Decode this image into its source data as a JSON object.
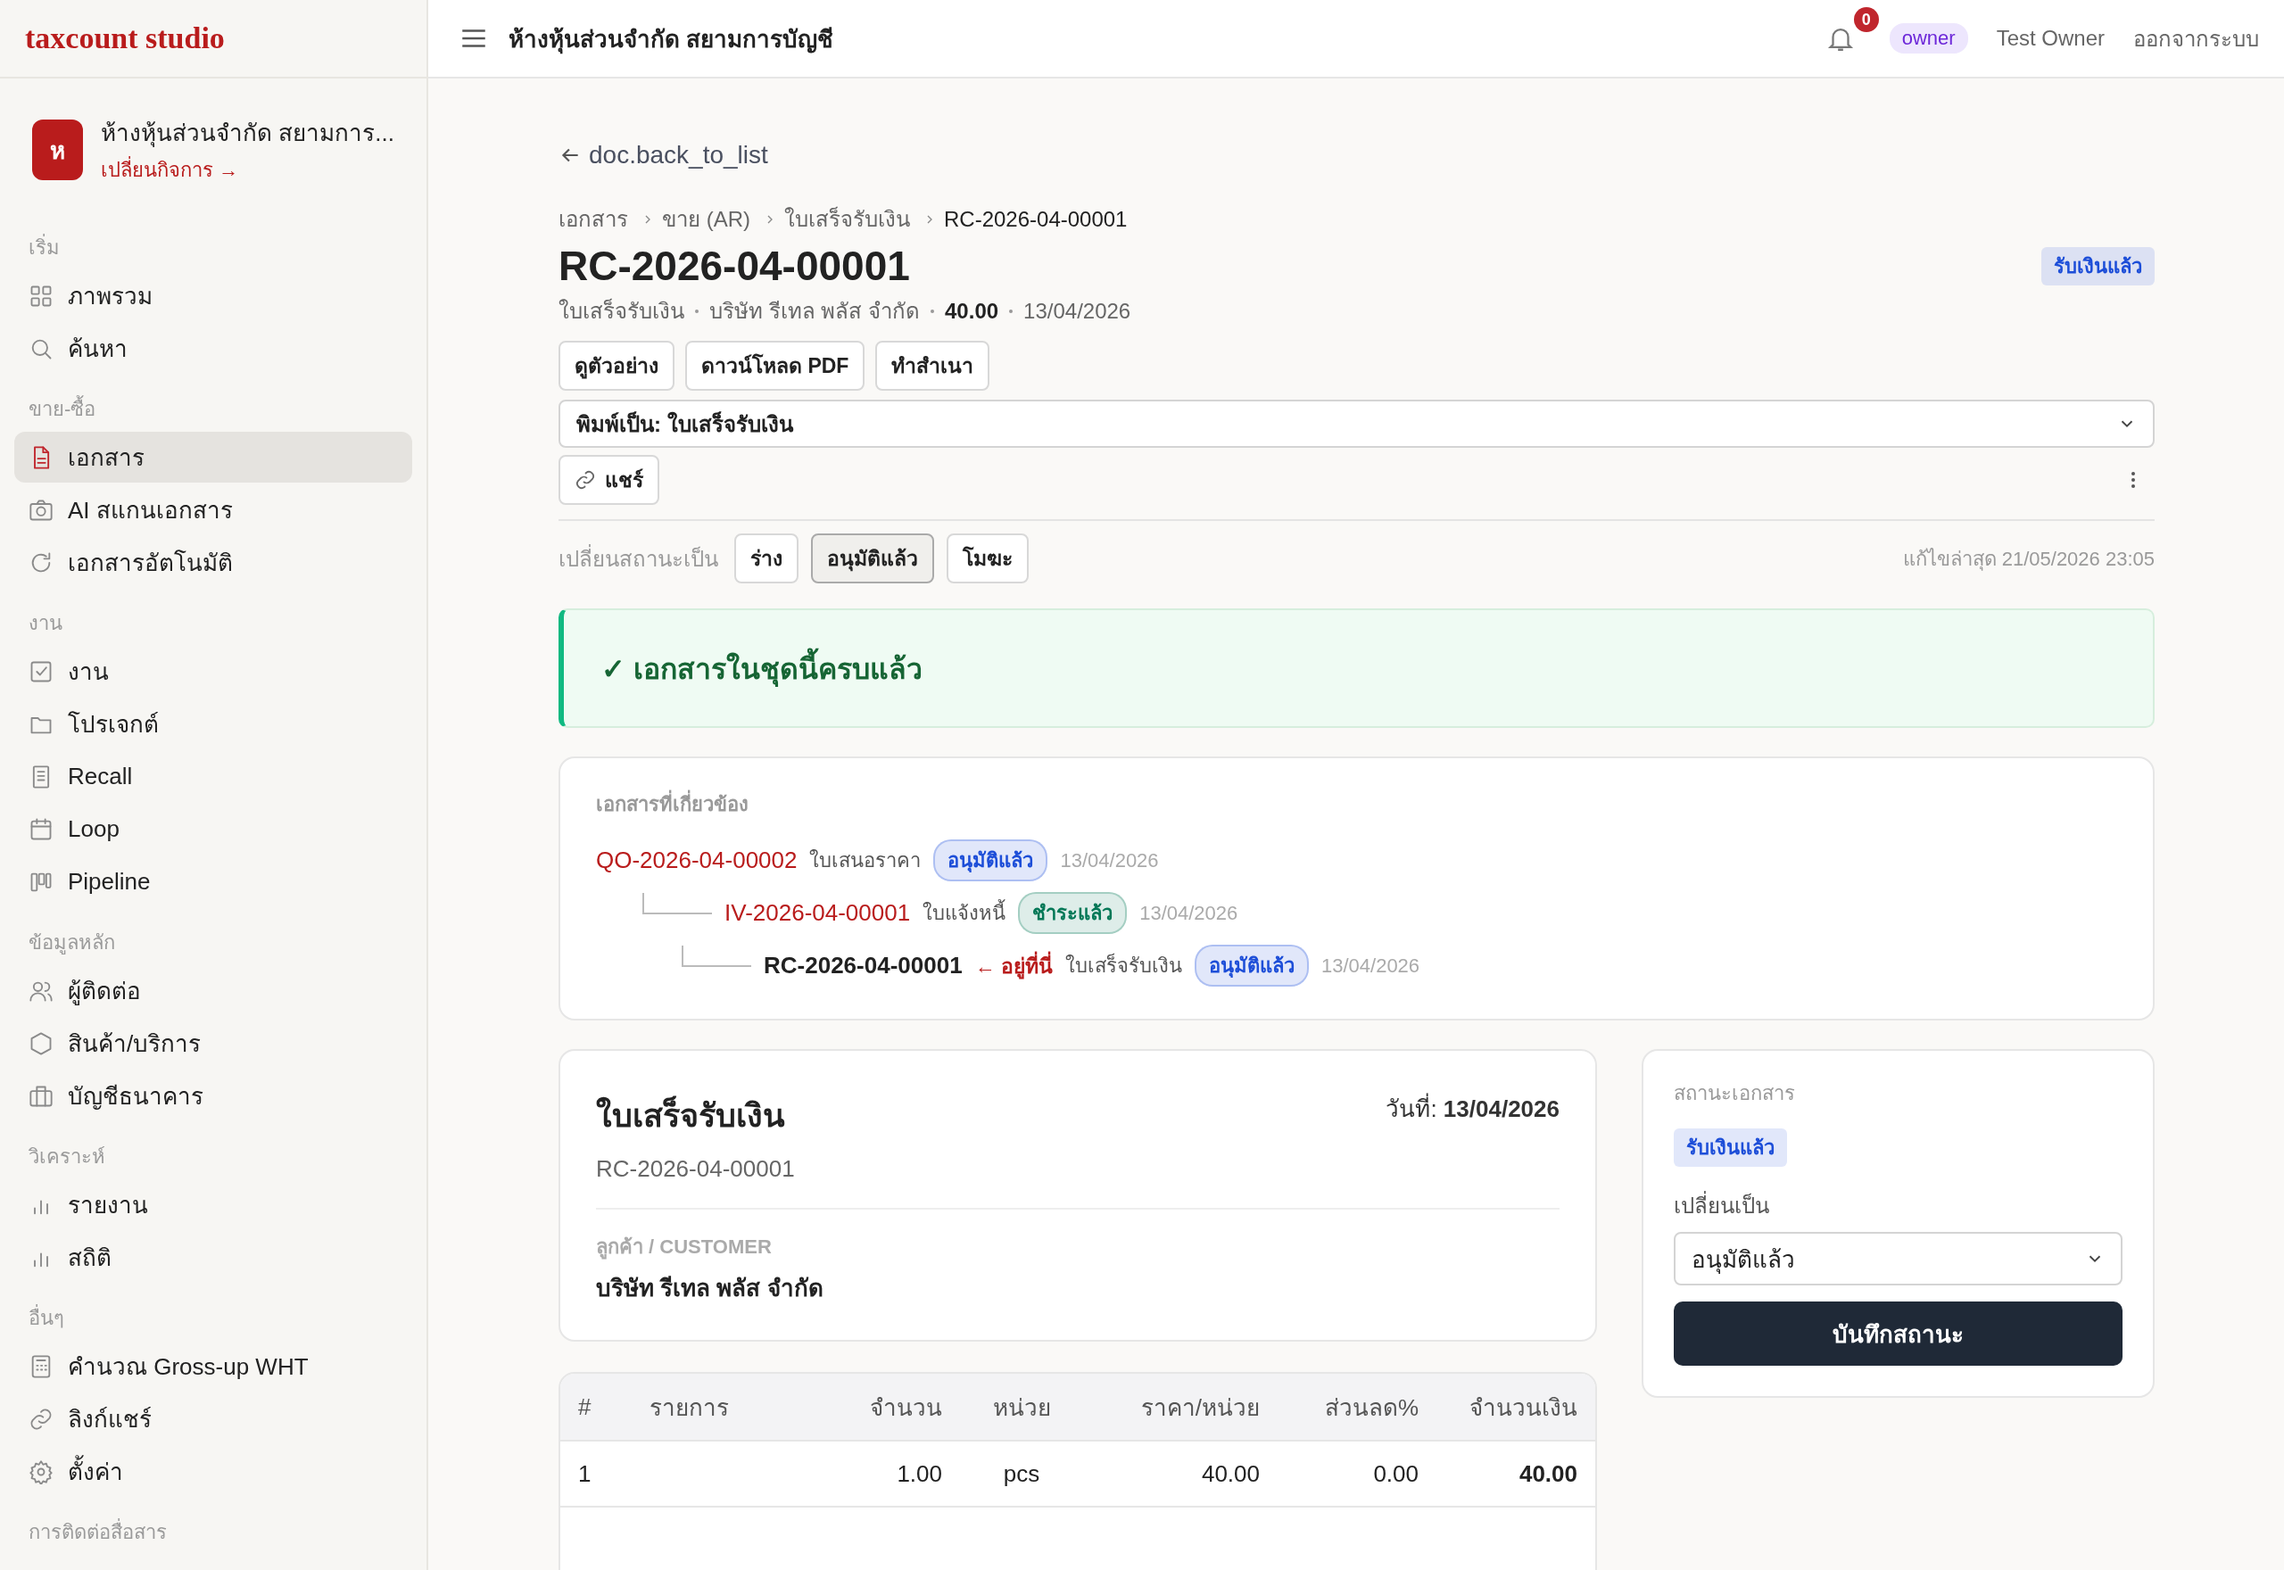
{
  "brand": "taxcount studio",
  "company": {
    "initial": "ห",
    "name": "ห้างหุ้นส่วนจำกัด สยามการ...",
    "switch_label": "เปลี่ยนกิจการ →"
  },
  "sidebar": {
    "sections": [
      {
        "title": "เริ่ม",
        "items": [
          {
            "label": "ภาพรวม",
            "selected": false
          },
          {
            "label": "ค้นหา",
            "selected": false
          }
        ]
      },
      {
        "title": "ขาย-ซื้อ",
        "items": [
          {
            "label": "เอกสาร",
            "selected": true
          },
          {
            "label": "AI สแกนเอกสาร",
            "selected": false
          },
          {
            "label": "เอกสารอัตโนมัติ",
            "selected": false
          }
        ]
      },
      {
        "title": "งาน",
        "items": [
          {
            "label": "งาน",
            "selected": false
          },
          {
            "label": "โปรเจกต์",
            "selected": false
          },
          {
            "label": "Recall",
            "selected": false
          },
          {
            "label": "Loop",
            "selected": false
          },
          {
            "label": "Pipeline",
            "selected": false
          }
        ]
      },
      {
        "title": "ข้อมูลหลัก",
        "items": [
          {
            "label": "ผู้ติดต่อ",
            "selected": false
          },
          {
            "label": "สินค้า/บริการ",
            "selected": false
          },
          {
            "label": "บัญชีธนาคาร",
            "selected": false
          }
        ]
      },
      {
        "title": "วิเคราะห์",
        "items": [
          {
            "label": "รายงาน",
            "selected": false
          },
          {
            "label": "สถิติ",
            "selected": false
          }
        ]
      },
      {
        "title": "อื่นๆ",
        "items": [
          {
            "label": "คำนวณ Gross-up WHT",
            "selected": false
          },
          {
            "label": "ลิงก์แชร์",
            "selected": false
          },
          {
            "label": "ตั้งค่า",
            "selected": false
          }
        ]
      },
      {
        "title": "การติดต่อสื่อสาร"
      }
    ]
  },
  "header": {
    "title": "ห้างหุ้นส่วนจำกัด สยามการบัญชี",
    "notifications": "0",
    "role": "owner",
    "user": "Test Owner",
    "logout": "ออกจากระบบ"
  },
  "document": {
    "back_link": "doc.back_to_list",
    "breadcrumb": [
      "เอกสาร",
      "ขาย (AR)",
      "ใบเสร็จรับเงิน",
      "RC-2026-04-00001"
    ],
    "title": "RC-2026-04-00001",
    "status_badge": {
      "label": "รับเงินแล้ว",
      "color": "#1d4ed8"
    },
    "meta": {
      "doc_type": "ใบเสร็จรับเงิน",
      "customer": "บริษัท รีเทล พลัส จำกัด",
      "amount": "40.00",
      "date": "13/04/2026"
    },
    "actions": [
      "ดูตัวอย่าง",
      "ดาวน์โหลด PDF",
      "ทำสำเนา"
    ],
    "print_as": "พิมพ์เป็น: ใบเสร็จรับเงิน",
    "share": "แชร์"
  },
  "status_change": {
    "label": "เปลี่ยนสถานะเป็น",
    "options": [
      {
        "label": "ร่าง",
        "selected": false
      },
      {
        "label": "อนุมัติแล้ว",
        "selected": true
      },
      {
        "label": "โมฆะ",
        "selected": false
      }
    ],
    "last_edited": "แก้ไขล่าสุด 21/05/2026 23:05"
  },
  "banner": {
    "text": "✓ เอกสารในชุดนี้ครบแล้ว"
  },
  "related": {
    "title": "เอกสารที่เกี่ยวข้อง",
    "items": [
      {
        "number": "QO-2026-04-00002",
        "type": "ใบเสนอราคา",
        "status": "อนุมัติแล้ว",
        "color": "#1d4ed8",
        "date": "13/04/2026",
        "current": false,
        "children": [
          {
            "number": "IV-2026-04-00001",
            "type": "ใบแจ้งหนี้",
            "status": "ชำระแล้ว",
            "color": "#047857",
            "date": "13/04/2026",
            "current": false,
            "children": [
              {
                "number": "RC-2026-04-00001",
                "here_label": "← อยู่ที่นี่",
                "type": "ใบเสร็จรับเงิน",
                "status": "อนุมัติแล้ว",
                "color": "#1d4ed8",
                "date": "13/04/2026",
                "current": true
              }
            ]
          }
        ]
      }
    ]
  },
  "receipt": {
    "title": "ใบเสร็จรับเงิน",
    "date_label": "วันที่:",
    "date": "13/04/2026",
    "number": "RC-2026-04-00001",
    "customer_label": "ลูกค้า / CUSTOMER",
    "customer": "บริษัท รีเทล พลัส จำกัด"
  },
  "items_table": {
    "columns": [
      "#",
      "รายการ",
      "จำนวน",
      "หน่วย",
      "ราคา/หน่วย",
      "ส่วนลด%",
      "จำนวนเงิน"
    ],
    "rows": [
      {
        "no": "1",
        "quantity": "1.00",
        "unit": "pcs",
        "price": "40.00",
        "discount": "0.00",
        "amount": "40.00"
      }
    ]
  },
  "status_panel": {
    "title": "สถานะเอกสาร",
    "badge": {
      "label": "รับเงินแล้ว",
      "color": "#1d4ed8"
    },
    "change_label": "เปลี่ยนเป็น",
    "select_value": "อนุมัติแล้ว",
    "save": "บันทึกสถานะ"
  }
}
